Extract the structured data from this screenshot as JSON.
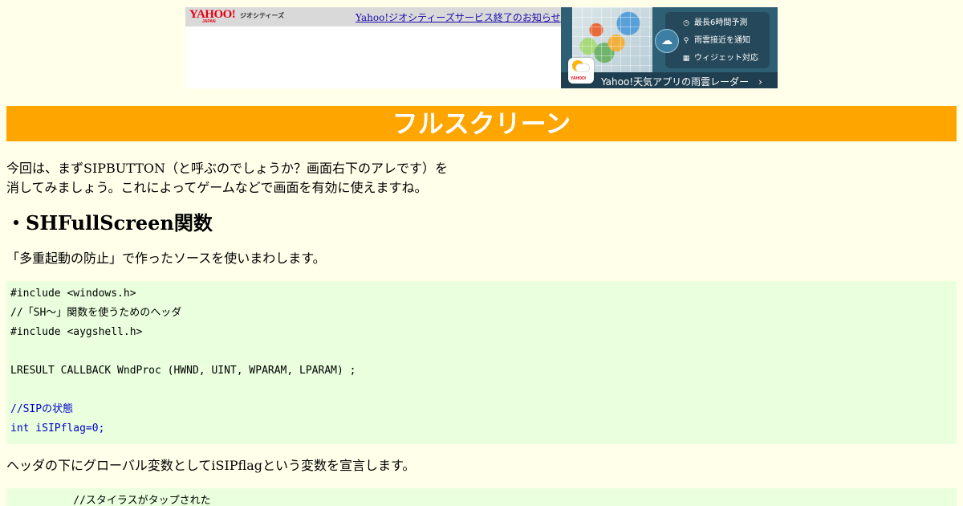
{
  "banner": {
    "logo_text": "YAHOO!",
    "logo_sub": "JAPAN",
    "service_label": "ジオシティーズ",
    "notice_link": "Yahoo!ジオシティーズサービス終了のお知らせ",
    "ad": {
      "features": [
        {
          "icon": "clock-icon",
          "glyph": "◷",
          "label": "最長6時間予測"
        },
        {
          "icon": "pin-icon",
          "glyph": "⚲",
          "label": "雨雲接近を通知"
        },
        {
          "icon": "widget-icon",
          "glyph": "▦",
          "label": "ウィジェット対応"
        }
      ],
      "app_icon_text": "YAHOO!",
      "footer_text": "Yahoo!天気アプリの雨雲レーダー　›"
    }
  },
  "page": {
    "title": "フルスクリーン",
    "intro_line1": "今回は、まずSIPBUTTON（と呼ぶのでしょうか？画面右下のアレです）を",
    "intro_line2": "消してみましょう。これによってゲームなどで画面を有効に使えますね。",
    "section_heading": "・SHFullScreen関数",
    "section_text": "「多重起動の防止」で作ったソースを使いまわします。",
    "after_code_text": "ヘッダの下にグローバル変数としてiSIPflagという変数を宣言します。"
  },
  "code_block_1": {
    "lines": [
      "#include <windows.h>",
      "//「SH～」関数を使うためのヘッダ",
      "#include <aygshell.h>",
      "",
      "LRESULT CALLBACK WndProc (HWND, UINT, WPARAM, LPARAM) ;",
      "",
      "//SIPの状態",
      "int iSIPflag=0;"
    ]
  },
  "code_block_2": {
    "lines": [
      "          //スタイラスがタップされた"
    ]
  },
  "colors": {
    "title_bg": "#ffa500",
    "page_bg": "#ffffea",
    "code_bg": "#e9ffdd",
    "highlight_code": "#0000cc"
  }
}
